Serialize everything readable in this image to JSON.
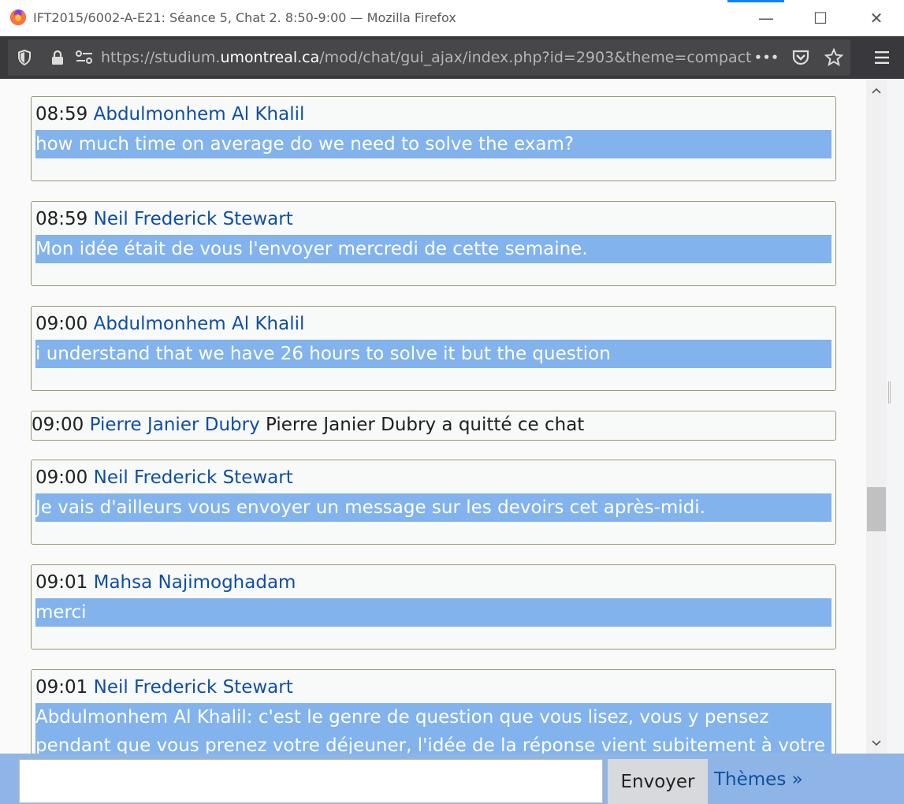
{
  "window": {
    "title": "IFT2015/6002-A-E21: Séance 5, Chat 2. 8:50-9:00 — Mozilla Firefox",
    "min_glyph": "—",
    "max_glyph": "☐",
    "close_glyph": "✕"
  },
  "urlbar": {
    "prefix": "https://studium.",
    "host": "umontreal.ca",
    "path": "/mod/chat/gui_ajax/index.php?id=2903&theme=compact",
    "more_glyph": "•••"
  },
  "messages": [
    {
      "time": "08:59",
      "user": "Abdulmonhem Al Khalil",
      "text": "how much time on average do we need to solve the exam?"
    },
    {
      "time": "08:59",
      "user": "Neil Frederick Stewart",
      "text": "Mon idée était de vous l'envoyer mercredi de cette semaine."
    },
    {
      "time": "09:00",
      "user": "Abdulmonhem Al Khalil",
      "text": "i understand that we have 26 hours to solve it but the question"
    },
    {
      "time": "09:00",
      "user": "Pierre Janier Dubry",
      "text": "Pierre Janier Dubry a quitté ce chat"
    },
    {
      "time": "09:00",
      "user": "Neil Frederick Stewart",
      "text": "Je vais d'ailleurs vous envoyer un message sur les devoirs cet après-midi."
    },
    {
      "time": "09:01",
      "user": "Mahsa Najimoghadam",
      "text": "merci"
    },
    {
      "time": "09:01",
      "user": "Neil Frederick Stewart",
      "text": "Abdulmonhem Al Khalil: c'est le genre de question que vous lisez, vous y pensez pendant que vous prenez votre déjeuner, l'idée de la réponse vient subitement à votre esprit, et"
    }
  ],
  "compose": {
    "value": "",
    "send_label": "Envoyer",
    "themes_label": "Thèmes »"
  },
  "colors": {
    "message_highlight": "#82b3ec",
    "username": "#0f4fa0",
    "input_bar": "#8fb5e6"
  }
}
